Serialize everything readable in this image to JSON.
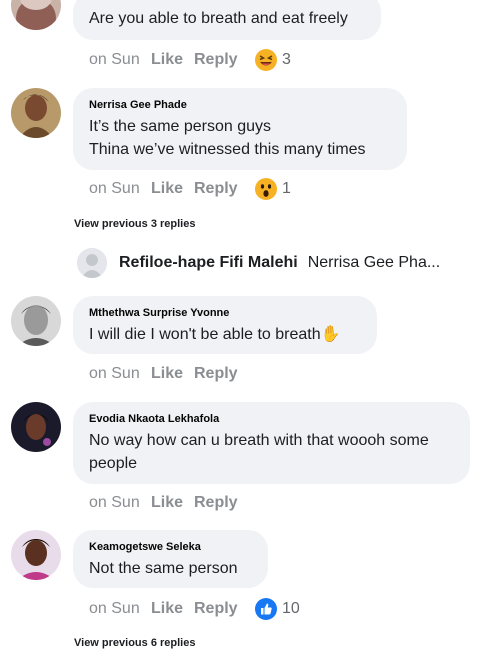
{
  "comments": [
    {
      "author": "",
      "lines": [
        "Are you able to breath and eat freely"
      ],
      "time": "on Sun",
      "like": "Like",
      "reply": "Reply",
      "reaction_icon": "laughing-emoji",
      "reaction_count": "3"
    },
    {
      "author": "Nerrisa Gee Phade",
      "lines": [
        "It’s the same person guys",
        "Thina we’ve witnessed this many times"
      ],
      "time": "on Sun",
      "like": "Like",
      "reply": "Reply",
      "reaction_icon": "wow-emoji",
      "reaction_count": "1"
    },
    {
      "author": "Mthethwa Surprise Yvonne",
      "lines": [
        "I will die I won't be able to breath✋"
      ],
      "time": "on Sun",
      "like": "Like",
      "reply": "Reply"
    },
    {
      "author": "Evodia Nkaota Lekhafola",
      "lines": [
        "No way how can u breath with that woooh some",
        "people"
      ],
      "time": "on Sun",
      "like": "Like",
      "reply": "Reply"
    },
    {
      "author": "Keamogetswe Seleka",
      "lines": [
        "Not the same person"
      ],
      "time": "on Sun",
      "like": "Like",
      "reply": "Reply",
      "reaction_icon": "like-thumb-icon",
      "reaction_count": "10"
    }
  ],
  "view_previous_1": "View previous 3 replies",
  "reply_preview": {
    "name": "Refiloe-hape Fifi Malehi",
    "snippet": "Nerrisa Gee Pha..."
  },
  "view_previous_2": "View previous 6 replies",
  "colors": {
    "bubble": "#f0f2f5",
    "muted": "#8a8d91",
    "like_blue": "#1877f2",
    "emoji_yellow": "#f7b125"
  }
}
